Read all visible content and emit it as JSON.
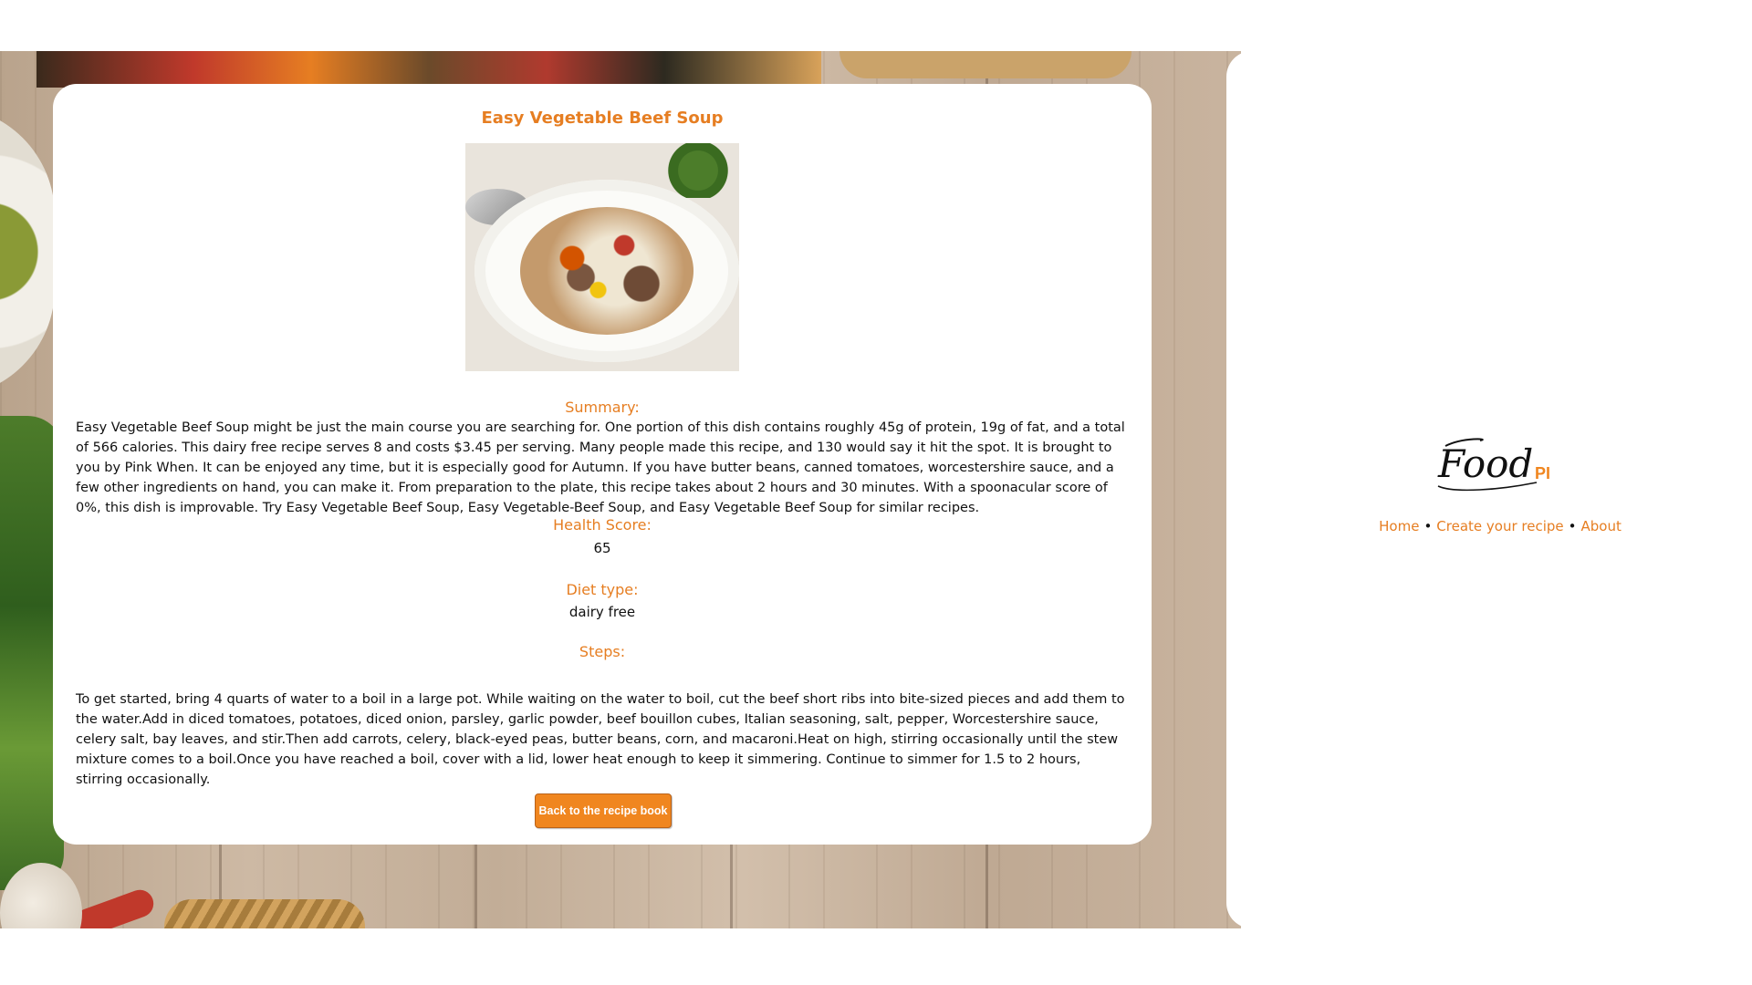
{
  "recipe": {
    "title": "Easy Vegetable Beef Soup",
    "image_alt": "Easy Vegetable Beef Soup photo",
    "summary_label": "Summary:",
    "summary_text": "Easy Vegetable Beef Soup might be just the main course you are searching for. One portion of this dish contains roughly 45g of protein, 19g of fat, and a total of 566 calories. This dairy free recipe serves 8 and costs $3.45 per serving. Many people made this recipe, and 130 would say it hit the spot. It is brought to you by Pink When. It can be enjoyed any time, but it is especially good for Autumn. If you have butter beans, canned tomatoes, worcestershire sauce, and a few other ingredients on hand, you can make it. From preparation to the plate, this recipe takes about 2 hours and 30 minutes. With a spoonacular score of 0%, this dish is improvable. Try Easy Vegetable Beef Soup, Easy Vegetable-Beef Soup, and Easy Vegetable Beef Soup for similar recipes.",
    "health_score_label": "Health Score:",
    "health_score_value": "65",
    "diet_type_label": "Diet type:",
    "diet_type_value": "dairy free",
    "steps_label": "Steps:",
    "steps_text": "To get started, bring 4 quarts of water to a boil in a large pot. While waiting on the water to boil, cut the beef short ribs into bite-sized pieces and add them to the water.Add in diced tomatoes, potatoes, diced onion, parsley, garlic powder, beef bouillon cubes, Italian seasoning, salt, pepper, Worcestershire sauce, celery salt, bay leaves, and stir.Then add carrots, celery, black-eyed peas, butter beans, corn, and macaroni.Heat on high, stirring occasionally until the stew mixture comes to a boil.Once you have reached a boil, cover with a lid, lower heat enough to keep it simmering. Continue to simmer for 1.5 to 2 hours, stirring occasionally.",
    "back_button_label": "Back to the recipe book"
  },
  "sidebar": {
    "logo_main": "Food",
    "logo_suffix": "PI",
    "nav_items": [
      {
        "label": "Home"
      },
      {
        "label": "Create your recipe"
      },
      {
        "label": "About"
      }
    ],
    "separator": "•"
  },
  "colors": {
    "accent": "#e67e22",
    "button": "#f0861f",
    "text": "#111111"
  },
  "icons": {
    "logo": "foodpi-logo"
  }
}
